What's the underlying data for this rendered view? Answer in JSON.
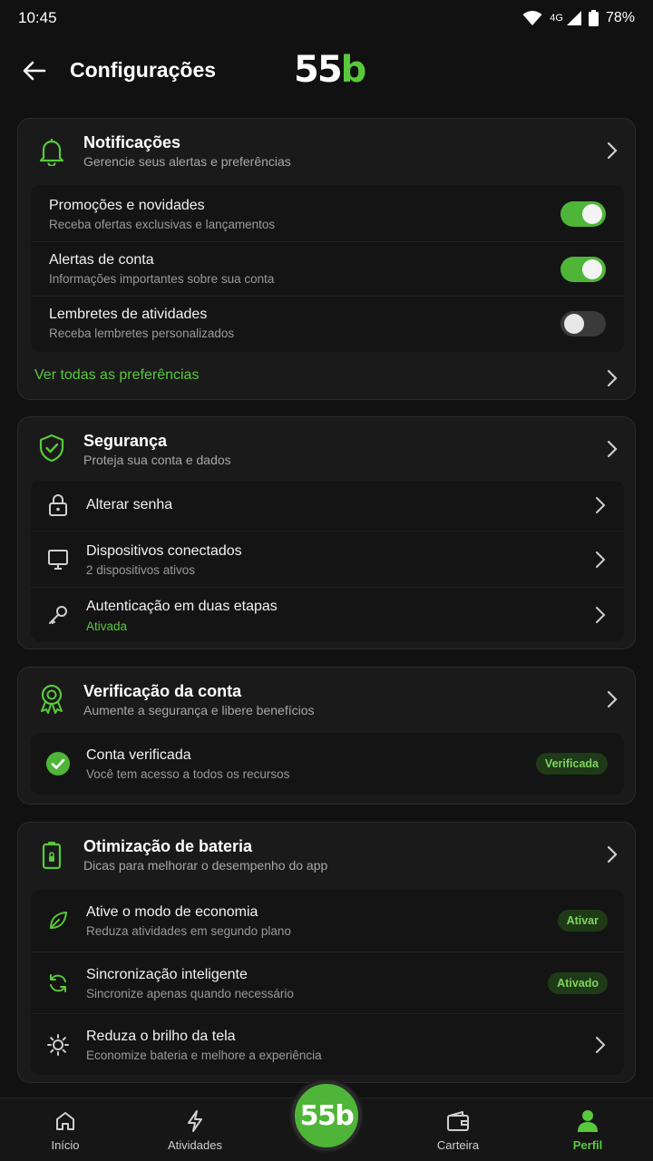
{
  "status_bar": {
    "time": "10:45",
    "network": "4G",
    "battery": "78%"
  },
  "header": {
    "title": "Configurações",
    "logo_main": "55",
    "logo_accent": "b"
  },
  "notifications": {
    "title": "Notificações",
    "subtitle": "Gerencie seus alertas e preferências",
    "items": [
      {
        "title": "Promoções e novidades",
        "subtitle": "Receba ofertas exclusivas e lançamentos",
        "enabled": true
      },
      {
        "title": "Alertas de conta",
        "subtitle": "Informações importantes sobre sua conta",
        "enabled": true
      },
      {
        "title": "Lembretes de atividades",
        "subtitle": "Receba lembretes personalizados",
        "enabled": false
      }
    ],
    "link": "Ver todas as preferências"
  },
  "security": {
    "title": "Segurança",
    "subtitle": "Proteja sua conta e dados",
    "items": [
      {
        "title": "Alterar senha",
        "icon": "lock-icon"
      },
      {
        "title": "Dispositivos conectados",
        "subtitle": "2 dispositivos ativos",
        "icon": "monitor-icon"
      },
      {
        "title": "Autenticação em duas etapas",
        "subtitle": "Ativada",
        "icon": "key-icon"
      }
    ]
  },
  "verification": {
    "title": "Verificação da conta",
    "subtitle": "Aumente a segurança e libere benefícios",
    "item": {
      "title": "Conta verificada",
      "subtitle": "Você tem acesso a todos os recursos",
      "badge": "Verificada"
    }
  },
  "battery": {
    "title": "Otimização de bateria",
    "subtitle": "Dicas para melhorar o desempenho do app",
    "items": [
      {
        "title": "Ative o modo de economia",
        "subtitle": "Reduza atividades em segundo plano",
        "badge": "Ativar"
      },
      {
        "title": "Sincronização inteligente",
        "subtitle": "Sincronize apenas quando necessário",
        "badge": "Ativado"
      },
      {
        "title": "Reduza o brilho da tela",
        "subtitle": "Economize bateria e melhore a experiência"
      }
    ]
  },
  "bottom_nav": {
    "items": [
      {
        "label": "Início",
        "icon": "home-icon"
      },
      {
        "label": "Atividades",
        "icon": "bolt-icon"
      },
      {
        "label": "Carteira",
        "icon": "wallet-icon"
      },
      {
        "label": "Perfil",
        "icon": "person-icon",
        "active": true
      }
    ],
    "center_logo_main": "55",
    "center_logo_accent": "b"
  },
  "colors": {
    "accent": "#58c93b",
    "background": "#111111",
    "card": "#1a1a1a"
  }
}
